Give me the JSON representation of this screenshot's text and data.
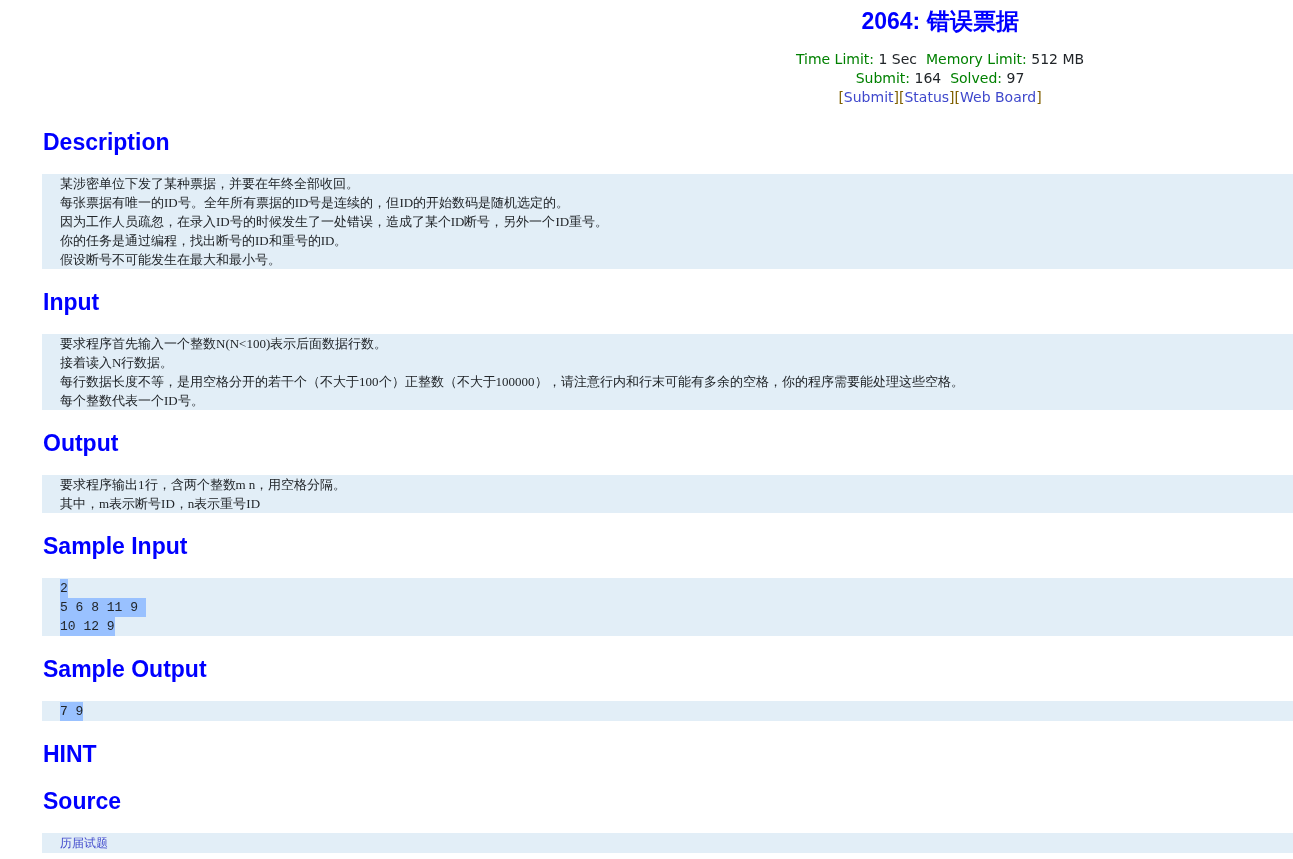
{
  "title": "2064: 错误票据",
  "limits": [
    {
      "label": "Time Limit:",
      "value": "1 Sec"
    },
    {
      "label": "Memory Limit:",
      "value": "512 MB"
    }
  ],
  "counts": [
    {
      "label": "Submit:",
      "value": "164"
    },
    {
      "label": "Solved:",
      "value": "97"
    }
  ],
  "links": [
    {
      "open": "[",
      "label": "Submit",
      "close": "]"
    },
    {
      "open": "[",
      "label": "Status",
      "close": "]"
    },
    {
      "open": "[",
      "label": "Web Board",
      "close": "]"
    }
  ],
  "sections": [
    {
      "heading": "Description",
      "kind": "text",
      "lines": [
        {
          "text": "某涉密单位下发了某种票据，并要在年终全部收回。"
        },
        {
          "text": "每张票据有唯一的ID号。全年所有票据的ID号是连续的，但ID的开始数码是随机选定的。"
        },
        {
          "text": "因为工作人员疏忽，在录入ID号的时候发生了一处错误，造成了某个ID断号，另外一个ID重号。"
        },
        {
          "text": "你的任务是通过编程，找出断号的ID和重号的ID。"
        },
        {
          "text": "假设断号不可能发生在最大和最小号。"
        }
      ]
    },
    {
      "heading": "Input",
      "kind": "text",
      "lines": [
        {
          "text": "要求程序首先输入一个整数N(N<100)表示后面数据行数。"
        },
        {
          "text": "接着读入N行数据。"
        },
        {
          "text": "每行数据长度不等，是用空格分开的若干个（不大于100个）正整数（不大于100000），请注意行内和行末可能有多余的空格，你的程序需要能处理这些空格。"
        },
        {
          "text": "每个整数代表一个ID号。"
        }
      ]
    },
    {
      "heading": "Output",
      "kind": "text",
      "lines": [
        {
          "text": "要求程序输出1行，含两个整数m n，用空格分隔。"
        },
        {
          "text": "其中，m表示断号ID，n表示重号ID"
        }
      ]
    },
    {
      "heading": "Sample Input",
      "kind": "sample",
      "lines": [
        {
          "text": "2",
          "highlighted": true
        },
        {
          "text": "5 6 8 11 9 ",
          "highlighted": true
        },
        {
          "text": "10 12 9",
          "highlighted": true
        }
      ]
    },
    {
      "heading": "Sample Output",
      "kind": "sample",
      "lines": [
        {
          "text": "7 9",
          "highlighted": true
        }
      ]
    },
    {
      "heading": "HINT",
      "kind": "none"
    },
    {
      "heading": "Source",
      "kind": "link",
      "lines": [
        {
          "text": "历届试题"
        }
      ]
    }
  ]
}
